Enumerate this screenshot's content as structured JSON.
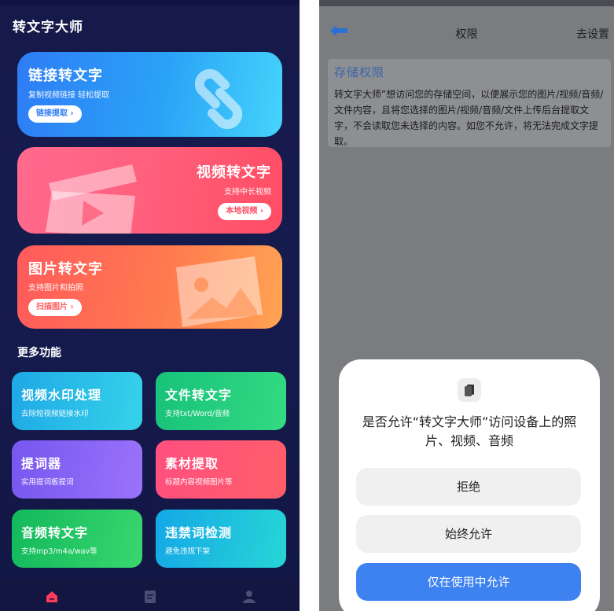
{
  "left": {
    "app_title": "转文字大师",
    "cards": [
      {
        "title": "链接转文字",
        "subtitle": "复制视频链接 轻松提取",
        "button": "链接提取 ›",
        "icon": "link-icon"
      },
      {
        "title": "视频转文字",
        "subtitle": "支持中长视频",
        "button": "本地视频 ›",
        "icon": "clapperboard-icon"
      },
      {
        "title": "图片转文字",
        "subtitle": "支持图片和拍照",
        "button": "扫描图片 ›",
        "icon": "image-icon"
      }
    ],
    "more_title": "更多功能",
    "tiles": [
      {
        "title": "视频水印处理",
        "subtitle": "去除短视频链接水印"
      },
      {
        "title": "文件转文字",
        "subtitle": "支持txt/Word/音频"
      },
      {
        "title": "提词器",
        "subtitle": "实用提词板提词"
      },
      {
        "title": "素材提取",
        "subtitle": "标题内容视频图片等"
      },
      {
        "title": "音频转文字",
        "subtitle": "支持mp3/m4a/wav等"
      },
      {
        "title": "违禁词检测",
        "subtitle": "避免违规下架"
      }
    ],
    "nav": [
      {
        "icon": "home-icon",
        "color": "#ff3b5c"
      },
      {
        "icon": "document-icon",
        "color": "#4a4f76"
      },
      {
        "icon": "profile-icon",
        "color": "#4a4f76"
      }
    ]
  },
  "right": {
    "header": {
      "back_icon": "back-arrow-icon",
      "title": "权限",
      "action": "去设置"
    },
    "permission": {
      "title": "存储权限",
      "description": "转文字大师”想访问您的存储空间，以便展示您的图片/视频/音频/文件内容，且将您选择的图片/视频/音频/文件上传后台提取文字，不会读取您未选择的内容。如您不允许，将无法完成文字提取。"
    },
    "dialog": {
      "icon": "file-icon",
      "question": "是否允许“转文字大师”访问设备上的照片、视频、音频",
      "options": {
        "deny": "拒绝",
        "always": "始终允许",
        "while_using": "仅在使用中允许"
      }
    }
  },
  "colors": {
    "accent": "#3d82f0",
    "background_dark": "#151a4a"
  }
}
